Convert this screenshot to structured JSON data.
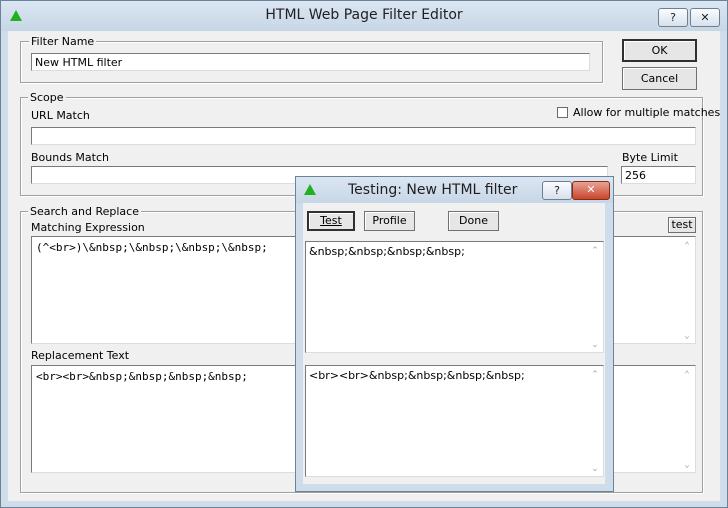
{
  "window": {
    "title": "HTML Web Page Filter Editor",
    "help_label": "?",
    "close_label": "✕"
  },
  "filter_name": {
    "group_label": "Filter Name",
    "value": "New HTML filter"
  },
  "buttons": {
    "ok": "OK",
    "cancel": "Cancel",
    "test_small": "test"
  },
  "scope": {
    "group_label": "Scope",
    "url_match_label": "URL Match",
    "url_match_value": "",
    "allow_multiple_label": "Allow for multiple matches",
    "allow_multiple_checked": false,
    "bounds_match_label": "Bounds Match",
    "bounds_match_value": "",
    "byte_limit_label": "Byte Limit",
    "byte_limit_value": "256"
  },
  "search_replace": {
    "group_label": "Search and Replace",
    "matching_label": "Matching Expression",
    "matching_value": "(^<br>)\\&nbsp;\\&nbsp;\\&nbsp;\\&nbsp;",
    "replacement_label": "Replacement Text",
    "replacement_value": "<br><br>&nbsp;&nbsp;&nbsp;&nbsp;"
  },
  "testing_dialog": {
    "title": "Testing: New HTML filter",
    "help_label": "?",
    "close_label": "✕",
    "test_button": "Test",
    "profile_button": "Profile",
    "done_button": "Done",
    "input_text": "&nbsp;&nbsp;&nbsp;&nbsp;",
    "output_text": "<br><br>&nbsp;&nbsp;&nbsp;&nbsp;"
  },
  "icons": {
    "app_icon": "green-triangle-icon",
    "scroll_up": "scroll-up-arrow-icon",
    "scroll_down": "scroll-down-arrow-icon"
  },
  "colors": {
    "titlebar": "#c7d6e6",
    "app_icon": "#20b020",
    "close_button": "#c9452c",
    "dialog_face": "#f0f0f0"
  }
}
